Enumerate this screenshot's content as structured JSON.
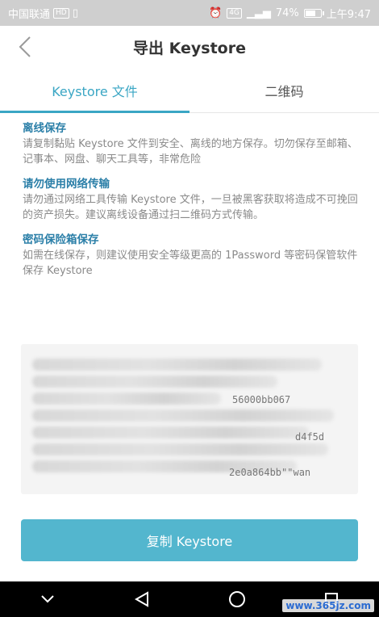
{
  "status_bar": {
    "carrier": "中国联通",
    "badge1": "HD",
    "badge2": "4G",
    "battery": "74%",
    "battery_level": 0.74,
    "time": "上午9:47"
  },
  "header": {
    "title": "导出 Keystore"
  },
  "tabs": [
    {
      "label": "Keystore 文件",
      "active": true
    },
    {
      "label": "二维码",
      "active": false
    }
  ],
  "sections": [
    {
      "title": "离线保存",
      "body": "请复制黏贴 Keystore 文件到安全、离线的地方保存。切勿保存至邮箱、记事本、网盘、聊天工具等，非常危险"
    },
    {
      "title": "请勿使用网络传输",
      "body": "请勿通过网络工具传输 Keystore 文件，一旦被黑客获取将造成不可挽回的资产损失。建议离线设备通过扫二维码方式传输。"
    },
    {
      "title": "密码保险箱保存",
      "body": "如需在线保存，则建议使用安全等级更高的 1Password 等密码保管软件保存 Keystore"
    }
  ],
  "keystore": {
    "fragment1": "56000bb067",
    "fragment2": "d4f5d",
    "fragment3": "2e0a864bb\"\"wan"
  },
  "copy_button": {
    "label": "复制 Keystore"
  },
  "watermark": "www.365jz.com",
  "colors": {
    "accent": "#3aa6c4",
    "button": "#53b6ce",
    "section_title": "#2b7fa8"
  }
}
